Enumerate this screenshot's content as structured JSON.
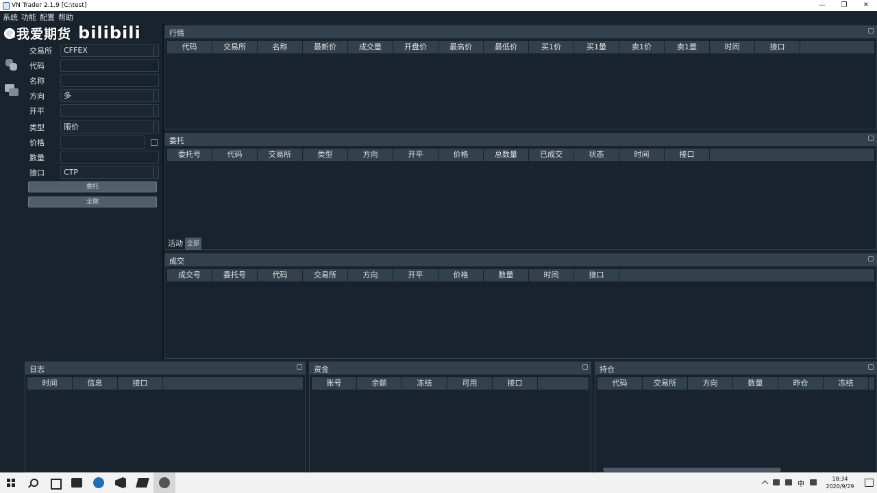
{
  "window": {
    "title": "VN Trader 2.1.9 [C:\\test]"
  },
  "menubar": [
    "系统",
    "功能",
    "配置",
    "帮助"
  ],
  "watermark": {
    "text": "我爱期货",
    "logo": "bilibili"
  },
  "trading": {
    "fields": [
      {
        "label": "交易所",
        "value": "CFFEX",
        "kind": "combo"
      },
      {
        "label": "代码",
        "value": "",
        "kind": "input"
      },
      {
        "label": "名称",
        "value": "",
        "kind": "input"
      },
      {
        "label": "方向",
        "value": "多",
        "kind": "combo"
      },
      {
        "label": "开平",
        "value": "",
        "kind": "combo"
      },
      {
        "label": "类型",
        "value": "限价",
        "kind": "combo"
      },
      {
        "label": "价格",
        "value": "",
        "kind": "input"
      },
      {
        "label": "数量",
        "value": "",
        "kind": "input"
      },
      {
        "label": "接口",
        "value": "CTP",
        "kind": "combo"
      }
    ],
    "buttons": [
      "委托",
      "全撤"
    ]
  },
  "tick": {
    "title": "行情",
    "headers": [
      "代码",
      "交易所",
      "名称",
      "最新价",
      "成交量",
      "开盘价",
      "最高价",
      "最低价",
      "买1价",
      "买1量",
      "卖1价",
      "卖1量",
      "时间",
      "接口"
    ]
  },
  "order": {
    "title": "委托",
    "headers": [
      "委托号",
      "代码",
      "交易所",
      "类型",
      "方向",
      "开平",
      "价格",
      "总数量",
      "已成交",
      "状态",
      "时间",
      "接口"
    ]
  },
  "order_tabs": {
    "active_tab": "活动",
    "all_tab": "全部"
  },
  "trade": {
    "title": "成交",
    "headers": [
      "成交号",
      "委托号",
      "代码",
      "交易所",
      "方向",
      "开平",
      "价格",
      "数量",
      "时间",
      "接口"
    ]
  },
  "log": {
    "title": "日志",
    "headers": [
      "时间",
      "信息",
      "接口"
    ]
  },
  "account": {
    "title": "资金",
    "headers": [
      "账号",
      "余额",
      "冻结",
      "可用",
      "接口"
    ]
  },
  "position": {
    "title": "持仓",
    "headers": [
      "代码",
      "交易所",
      "方向",
      "数量",
      "昨仓",
      "冻结"
    ]
  },
  "taskbar": {
    "ime": "中",
    "time": "18:34",
    "date": "2020/9/29"
  }
}
